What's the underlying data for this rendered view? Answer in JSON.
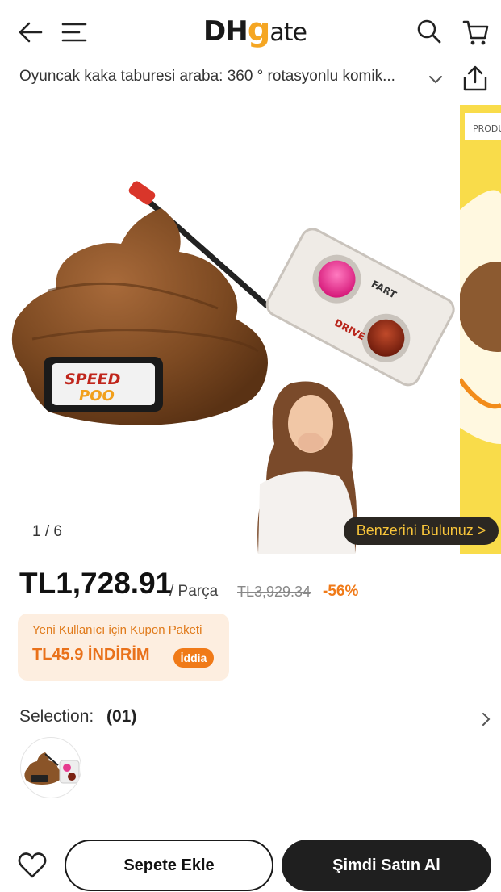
{
  "header": {
    "logo_dh": "DH",
    "logo_g": "g",
    "logo_ate": "ate",
    "icons": [
      "back-arrow-icon",
      "menu-icon",
      "search-icon",
      "cart-icon"
    ]
  },
  "product": {
    "title": "Oyuncak kaka taburesi araba: 360 ° rotasyonlu komik...",
    "gallery_counter": "1 / 6",
    "similar_label": "Benzerini Bulunuz >",
    "brand_badge_line1": "SPEED",
    "brand_badge_line2": "POO",
    "remote_drive": "DRIVE",
    "remote_fart": "FART",
    "side_image_label": "PRODU"
  },
  "pricing": {
    "price": "TL1,728.91",
    "unit": "/ Parça",
    "old_price": "TL3,929.34",
    "discount": "-56%"
  },
  "coupon": {
    "title": "Yeni Kullanıcı için Kupon Paketi",
    "value": "TL45.9 İNDİRİM",
    "claim_label": "İddia"
  },
  "selection": {
    "label": "Selection:",
    "count": "(01)"
  },
  "actions": {
    "add_to_cart": "Sepete Ekle",
    "buy_now": "Şimdi Satın Al"
  },
  "colors": {
    "accent_orange": "#f07a18",
    "logo_yellow": "#f5a623",
    "dark_button": "#1f1f1f",
    "coupon_bg": "#fdeee0"
  }
}
